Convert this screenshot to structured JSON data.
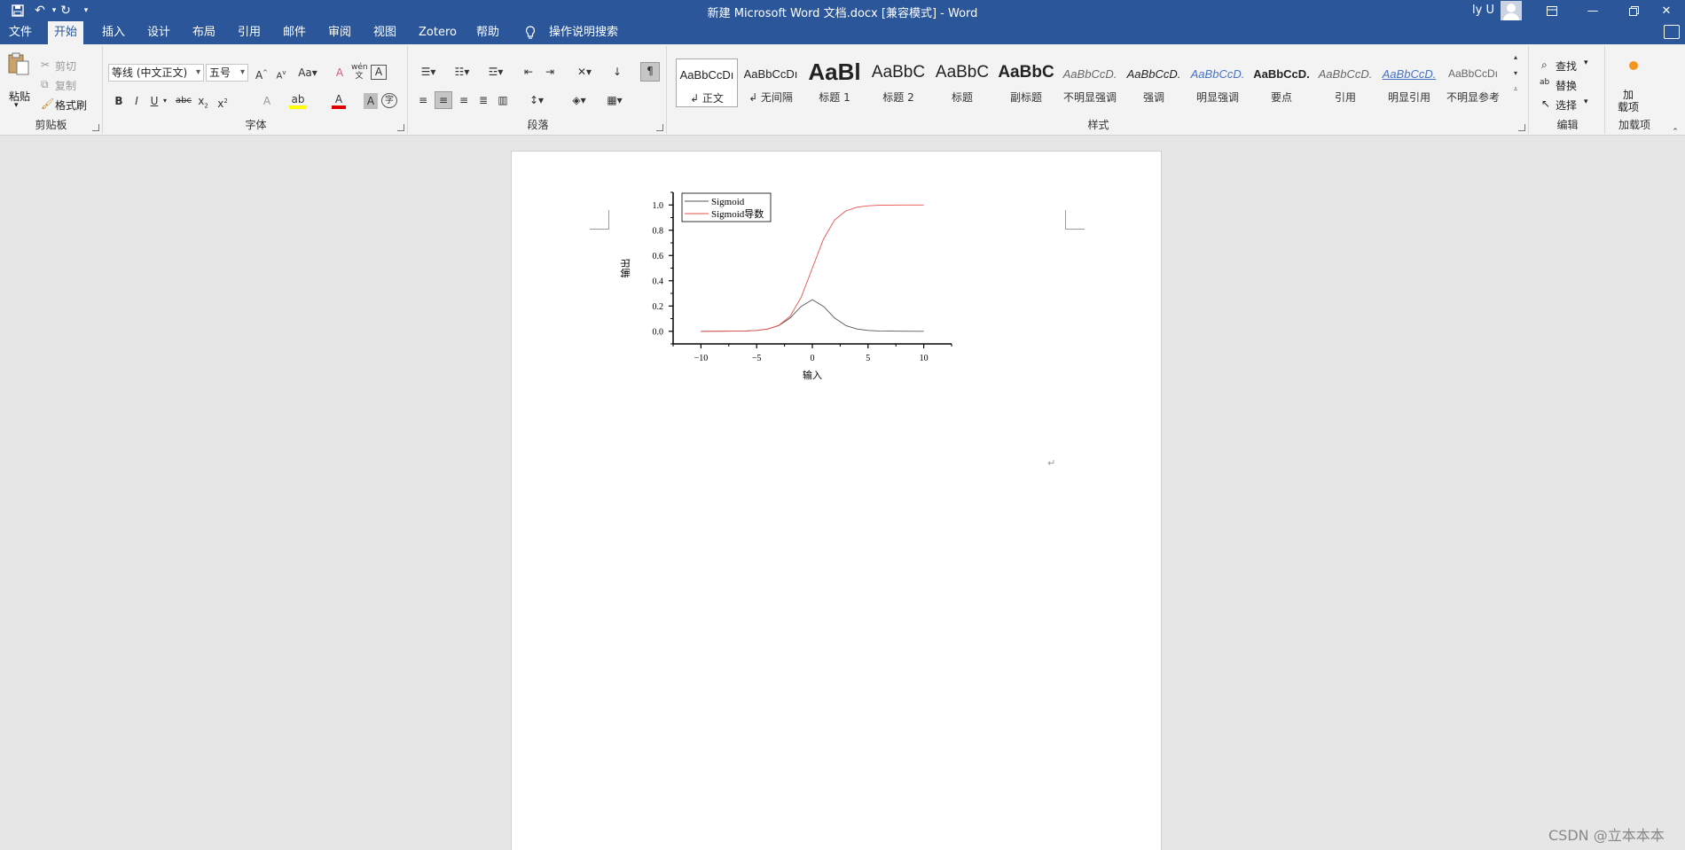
{
  "window": {
    "title": "新建 Microsoft Word 文档.docx [兼容模式]  -  Word",
    "user": "ly U"
  },
  "tabs": [
    {
      "label": "文件"
    },
    {
      "label": "开始"
    },
    {
      "label": "插入"
    },
    {
      "label": "设计"
    },
    {
      "label": "布局"
    },
    {
      "label": "引用"
    },
    {
      "label": "邮件"
    },
    {
      "label": "审阅"
    },
    {
      "label": "视图"
    },
    {
      "label": "Zotero"
    },
    {
      "label": "帮助"
    }
  ],
  "tell_me": "操作说明搜索",
  "clipboard": {
    "paste": "粘贴",
    "cut": "剪切",
    "copy": "复制",
    "format_painter": "格式刷",
    "group": "剪贴板"
  },
  "font": {
    "name": "等线 (中文正文)",
    "size": "五号",
    "group": "字体"
  },
  "paragraph": {
    "group": "段落"
  },
  "styles": {
    "group": "样式",
    "items": [
      {
        "preview": "AaBbCcDı",
        "name": "↲ 正文"
      },
      {
        "preview": "AaBbCcDı",
        "name": "↲ 无间隔"
      },
      {
        "preview": "AaBl",
        "name": "标题 1"
      },
      {
        "preview": "AaBbC",
        "name": "标题 2"
      },
      {
        "preview": "AaBbC",
        "name": "标题"
      },
      {
        "preview": "AaBbC",
        "name": "副标题"
      },
      {
        "preview": "AaBbCcD.",
        "name": "不明显强调"
      },
      {
        "preview": "AaBbCcD.",
        "name": "强调"
      },
      {
        "preview": "AaBbCcD.",
        "name": "明显强调"
      },
      {
        "preview": "AaBbCcD.",
        "name": "要点"
      },
      {
        "preview": "AaBbCcD.",
        "name": "引用"
      },
      {
        "preview": "AaBbCcD.",
        "name": "明显引用"
      },
      {
        "preview": "AaBbCcDı",
        "name": "不明显参考"
      }
    ]
  },
  "editing": {
    "find": "查找",
    "replace": "替换",
    "select": "选择",
    "group": "编辑"
  },
  "addins": {
    "button": "加\n载项",
    "group": "加载项"
  },
  "watermark": "CSDN @立本本本",
  "chart_data": {
    "type": "line",
    "xlabel": "输入",
    "ylabel": "输出",
    "xlim": [
      -12.5,
      12.5
    ],
    "ylim": [
      -0.1,
      1.1
    ],
    "xticks": [
      -10,
      -5,
      0,
      5,
      10
    ],
    "xtick_labels": [
      "−10",
      "−5",
      "0",
      "5",
      "10"
    ],
    "yticks": [
      0.0,
      0.2,
      0.4,
      0.6,
      0.8,
      1.0
    ],
    "ytick_labels": [
      "0.0",
      "0.2",
      "0.4",
      "0.6",
      "0.8",
      "1.0"
    ],
    "legend": "top-left",
    "grid": false,
    "series": [
      {
        "name": "Sigmoid",
        "color": "#555555",
        "x": [
          -10,
          -8,
          -6,
          -5,
          -4,
          -3,
          -2,
          -1,
          0,
          1,
          2,
          3,
          4,
          5,
          6,
          8,
          10
        ],
        "values": [
          0.0,
          0.0003,
          0.0025,
          0.0066,
          0.0177,
          0.0452,
          0.105,
          0.1966,
          0.25,
          0.1966,
          0.105,
          0.0452,
          0.0177,
          0.0066,
          0.0025,
          0.0003,
          0.0
        ]
      },
      {
        "name": "Sigmoid导数",
        "color": "#e8504a",
        "x": [
          -10,
          -8,
          -6,
          -5,
          -4,
          -3,
          -2,
          -1,
          0,
          1,
          2,
          3,
          4,
          5,
          6,
          8,
          10
        ],
        "values": [
          0.0,
          0.0003,
          0.0025,
          0.0067,
          0.018,
          0.0474,
          0.1192,
          0.2689,
          0.5,
          0.7311,
          0.8808,
          0.9526,
          0.982,
          0.9933,
          0.9975,
          0.9997,
          1.0
        ]
      }
    ]
  }
}
